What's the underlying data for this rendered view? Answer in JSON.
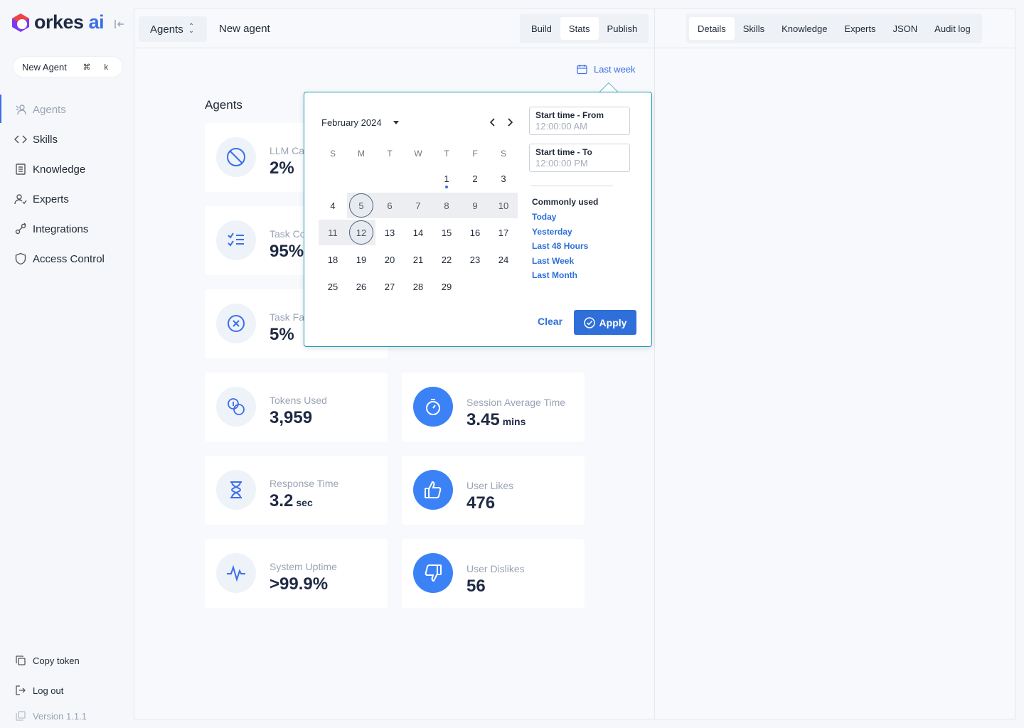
{
  "brand": {
    "name": "orkes",
    "suffix": "ai",
    "colors": {
      "accent": "#3b6ee8",
      "logo_red": "#ef4444",
      "logo_purple": "#7c3aed"
    }
  },
  "sidebar": {
    "new_agent_label": "New Agent",
    "shortcut": "⌘ k",
    "items": [
      {
        "label": "Agents",
        "icon": "agents-icon",
        "active": true
      },
      {
        "label": "Skills",
        "icon": "code-icon"
      },
      {
        "label": "Knowledge",
        "icon": "document-icon"
      },
      {
        "label": "Experts",
        "icon": "user-check-icon"
      },
      {
        "label": "Integrations",
        "icon": "plug-icon"
      },
      {
        "label": "Access Control",
        "icon": "shield-icon"
      }
    ],
    "copy_token": "Copy token",
    "log_out": "Log out",
    "version": "Version 1.1.1"
  },
  "topbar": {
    "agents_select": "Agents",
    "page_name": "New agent",
    "left_tabs": [
      {
        "label": "Build"
      },
      {
        "label": "Stats",
        "active": true
      },
      {
        "label": "Publish"
      }
    ],
    "right_tabs": [
      {
        "label": "Details",
        "active": true
      },
      {
        "label": "Skills"
      },
      {
        "label": "Knowledge"
      },
      {
        "label": "Experts"
      },
      {
        "label": "JSON"
      },
      {
        "label": "Audit log"
      }
    ]
  },
  "stats": {
    "range_label": "Last week",
    "heading": "Agents",
    "cards": [
      {
        "label": "LLM Ca",
        "value": "2%",
        "icon": "block-icon"
      },
      {
        "label": "Task Co",
        "value": "95%",
        "icon": "checklist-icon"
      },
      {
        "label": "Task Fa",
        "value": "5%",
        "icon": "x-circle-icon"
      },
      {
        "label": "Tokens Used",
        "value": "3,959",
        "icon": "coins-icon"
      },
      {
        "label": "Session Average Time",
        "value": "3.45",
        "unit": "mins",
        "icon": "stopwatch-icon"
      },
      {
        "label": "Response Time",
        "value": "3.2",
        "unit": "sec",
        "icon": "hourglass-icon"
      },
      {
        "label": "User Likes",
        "value": "476",
        "icon": "thumbs-up-icon"
      },
      {
        "label": "System Uptime",
        "value": ">99.9%",
        "icon": "pulse-icon"
      },
      {
        "label": "User Dislikes",
        "value": "56",
        "icon": "thumbs-down-icon"
      }
    ]
  },
  "datepicker": {
    "month_label": "February 2024",
    "weekdays": [
      "S",
      "M",
      "T",
      "W",
      "T",
      "F",
      "S"
    ],
    "weeks": [
      [
        "",
        "",
        "",
        "",
        "1",
        "2",
        "3"
      ],
      [
        "4",
        "5",
        "6",
        "7",
        "8",
        "9",
        "10"
      ],
      [
        "11",
        "12",
        "13",
        "14",
        "15",
        "16",
        "17"
      ],
      [
        "18",
        "19",
        "20",
        "21",
        "22",
        "23",
        "24"
      ],
      [
        "25",
        "26",
        "27",
        "28",
        "29",
        "",
        ""
      ]
    ],
    "range_start": "5",
    "range_end": "12",
    "today": "1",
    "start_from": {
      "label": "Start time - From",
      "placeholder": "12:00:00 AM"
    },
    "start_to": {
      "label": "Start time - To",
      "placeholder": "12:00:00 PM"
    },
    "commonly_used_title": "Commonly used",
    "commonly_used": [
      "Today",
      "Yesterday",
      "Last 48 Hours",
      "Last Week",
      "Last Month"
    ],
    "clear_label": "Clear",
    "apply_label": "Apply"
  }
}
